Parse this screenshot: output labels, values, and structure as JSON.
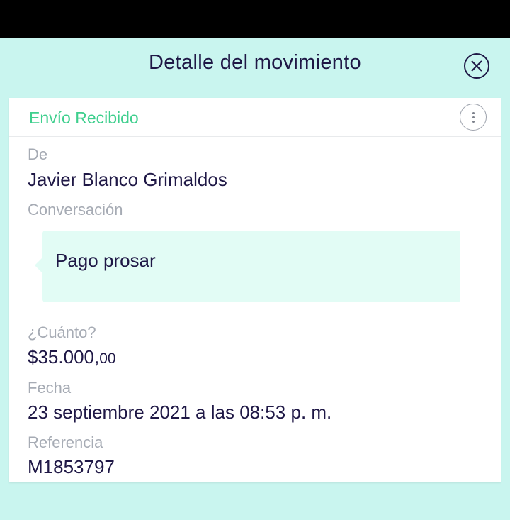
{
  "header": {
    "title": "Detalle del movimiento",
    "close_icon": "close-icon"
  },
  "card": {
    "type_label": "Envío Recibido",
    "more_icon": "more-vertical-icon",
    "from": {
      "label": "De",
      "value": "Javier Blanco Grimaldos"
    },
    "conversation": {
      "label": "Conversación",
      "message": "Pago prosar"
    },
    "amount": {
      "label": "¿Cuánto?",
      "value_main": "$35.000,",
      "value_cents": "00"
    },
    "date": {
      "label": "Fecha",
      "value": "23 septiembre 2021 a las 08:53 p. m."
    },
    "reference": {
      "label": "Referencia",
      "value": "M1853797"
    }
  },
  "colors": {
    "background": "#c9f5ef",
    "accent_green": "#3fcf8e",
    "text_dark": "#1f1846",
    "label_gray": "#a6abb4",
    "bubble": "#e2fcf5"
  }
}
